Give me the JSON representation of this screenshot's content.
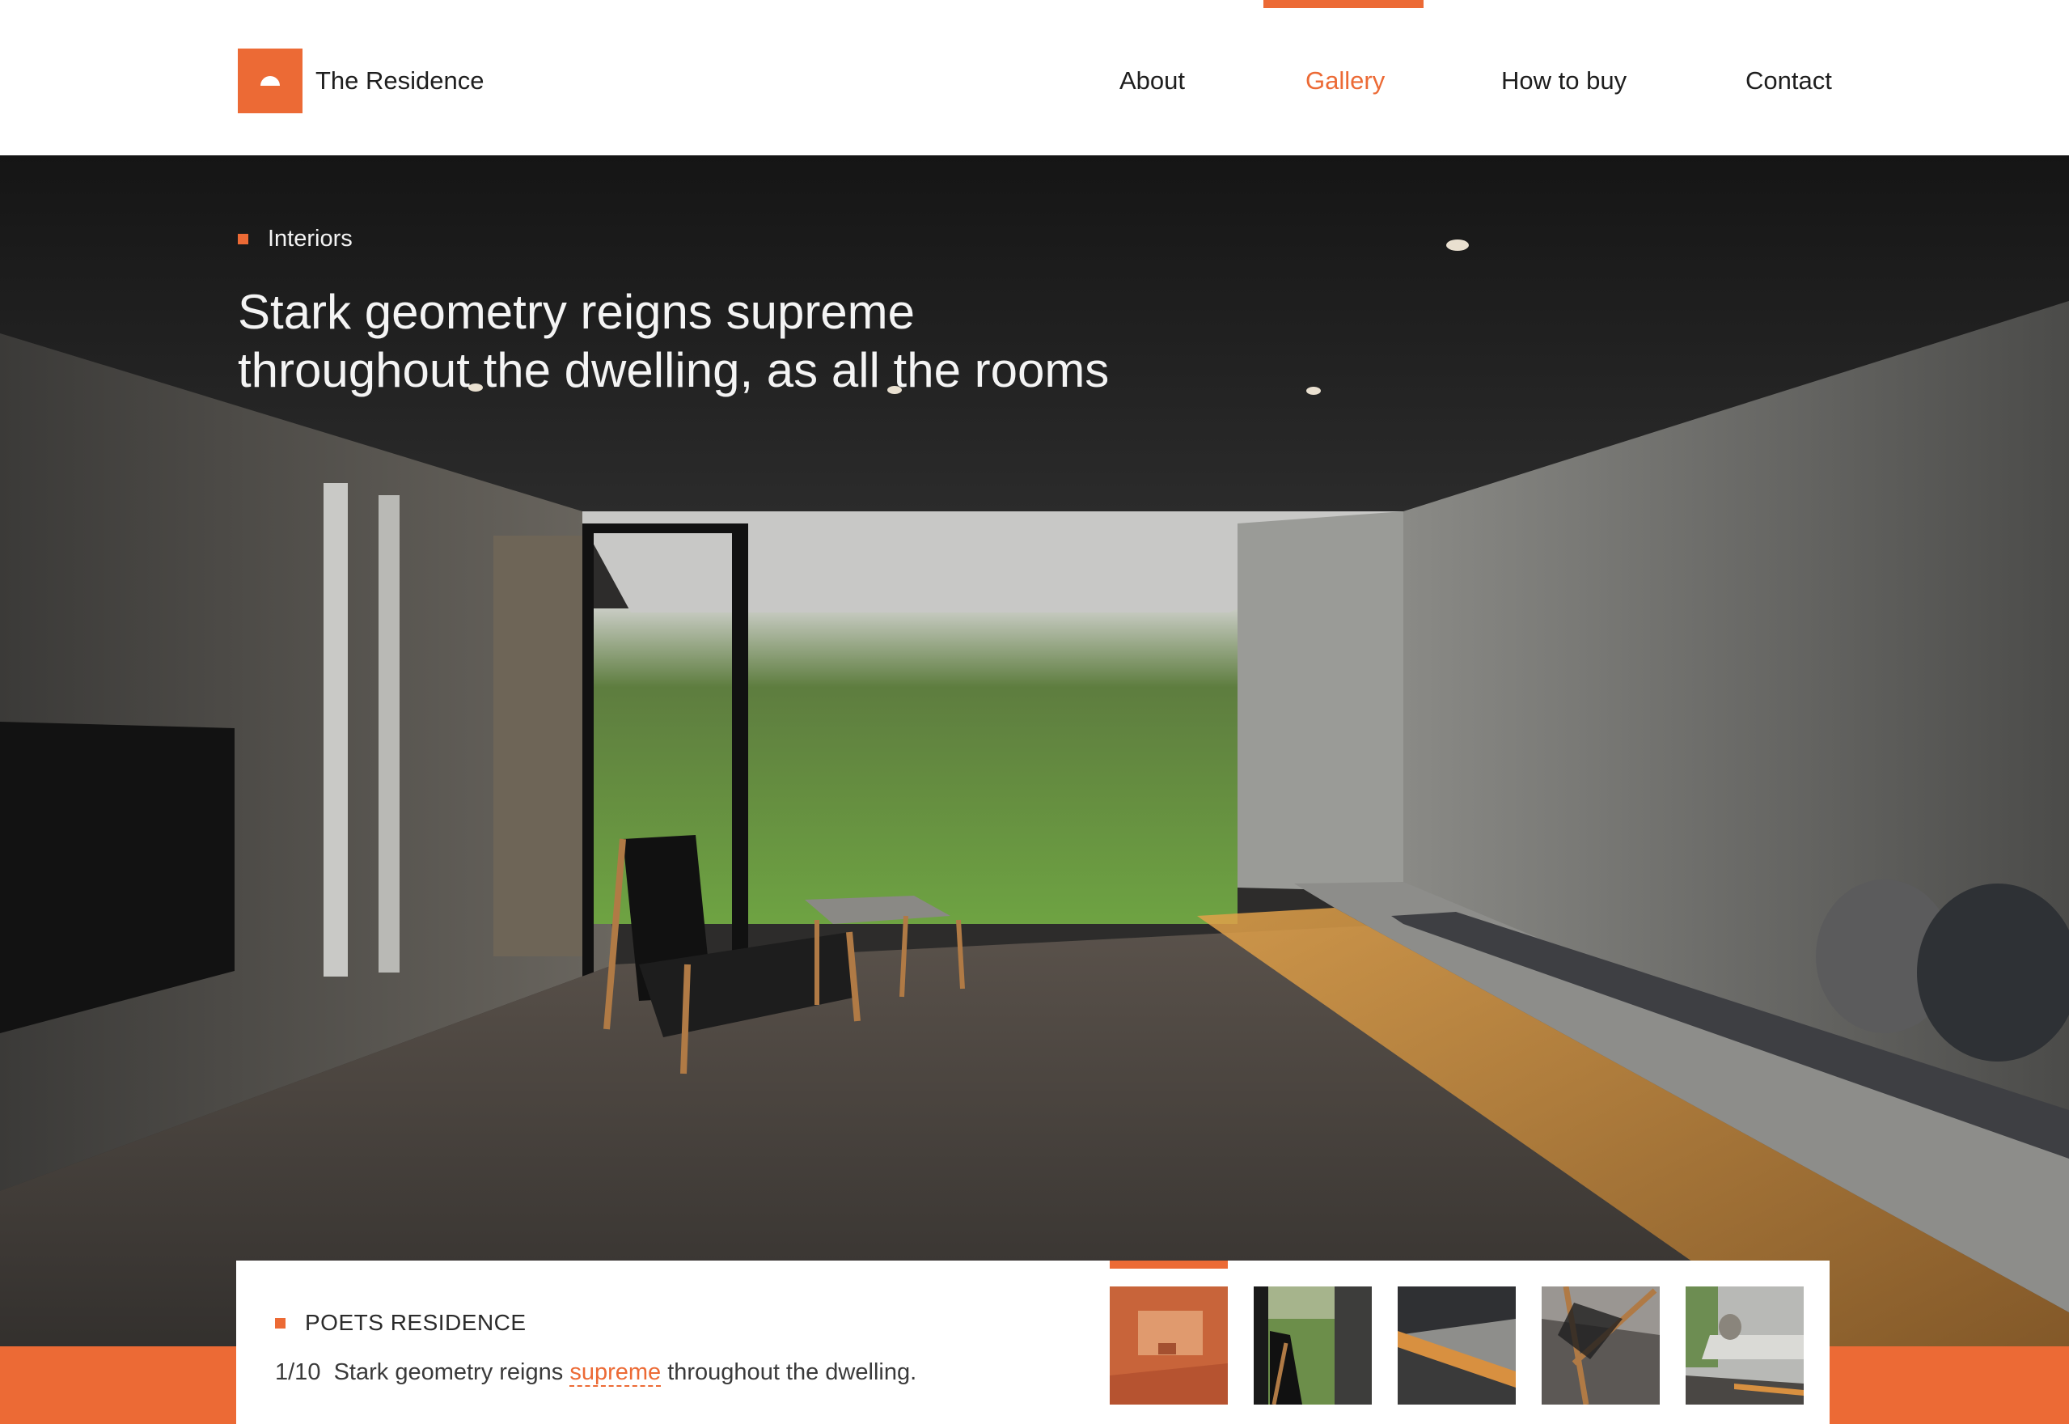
{
  "brand": {
    "name": "The Residence",
    "logo_icon": "half-circle-icon",
    "accent": "#ec6a35"
  },
  "nav": {
    "items": [
      {
        "label": "About",
        "active": false
      },
      {
        "label": "Gallery",
        "active": true
      },
      {
        "label": "How to buy",
        "active": false
      },
      {
        "label": "Contact",
        "active": false
      }
    ]
  },
  "hero": {
    "category": "Interiors",
    "headline_lines": [
      "Stark geometry reigns supreme",
      "throughout the dwelling, as all the rooms"
    ]
  },
  "panel": {
    "title": "POETS RESIDENCE",
    "counter": "1/10",
    "caption_before": "Stark geometry reigns",
    "caption_highlight": "supreme",
    "caption_after": "throughout the dwelling."
  },
  "thumbnails": {
    "count": 5,
    "active_index": 0
  }
}
